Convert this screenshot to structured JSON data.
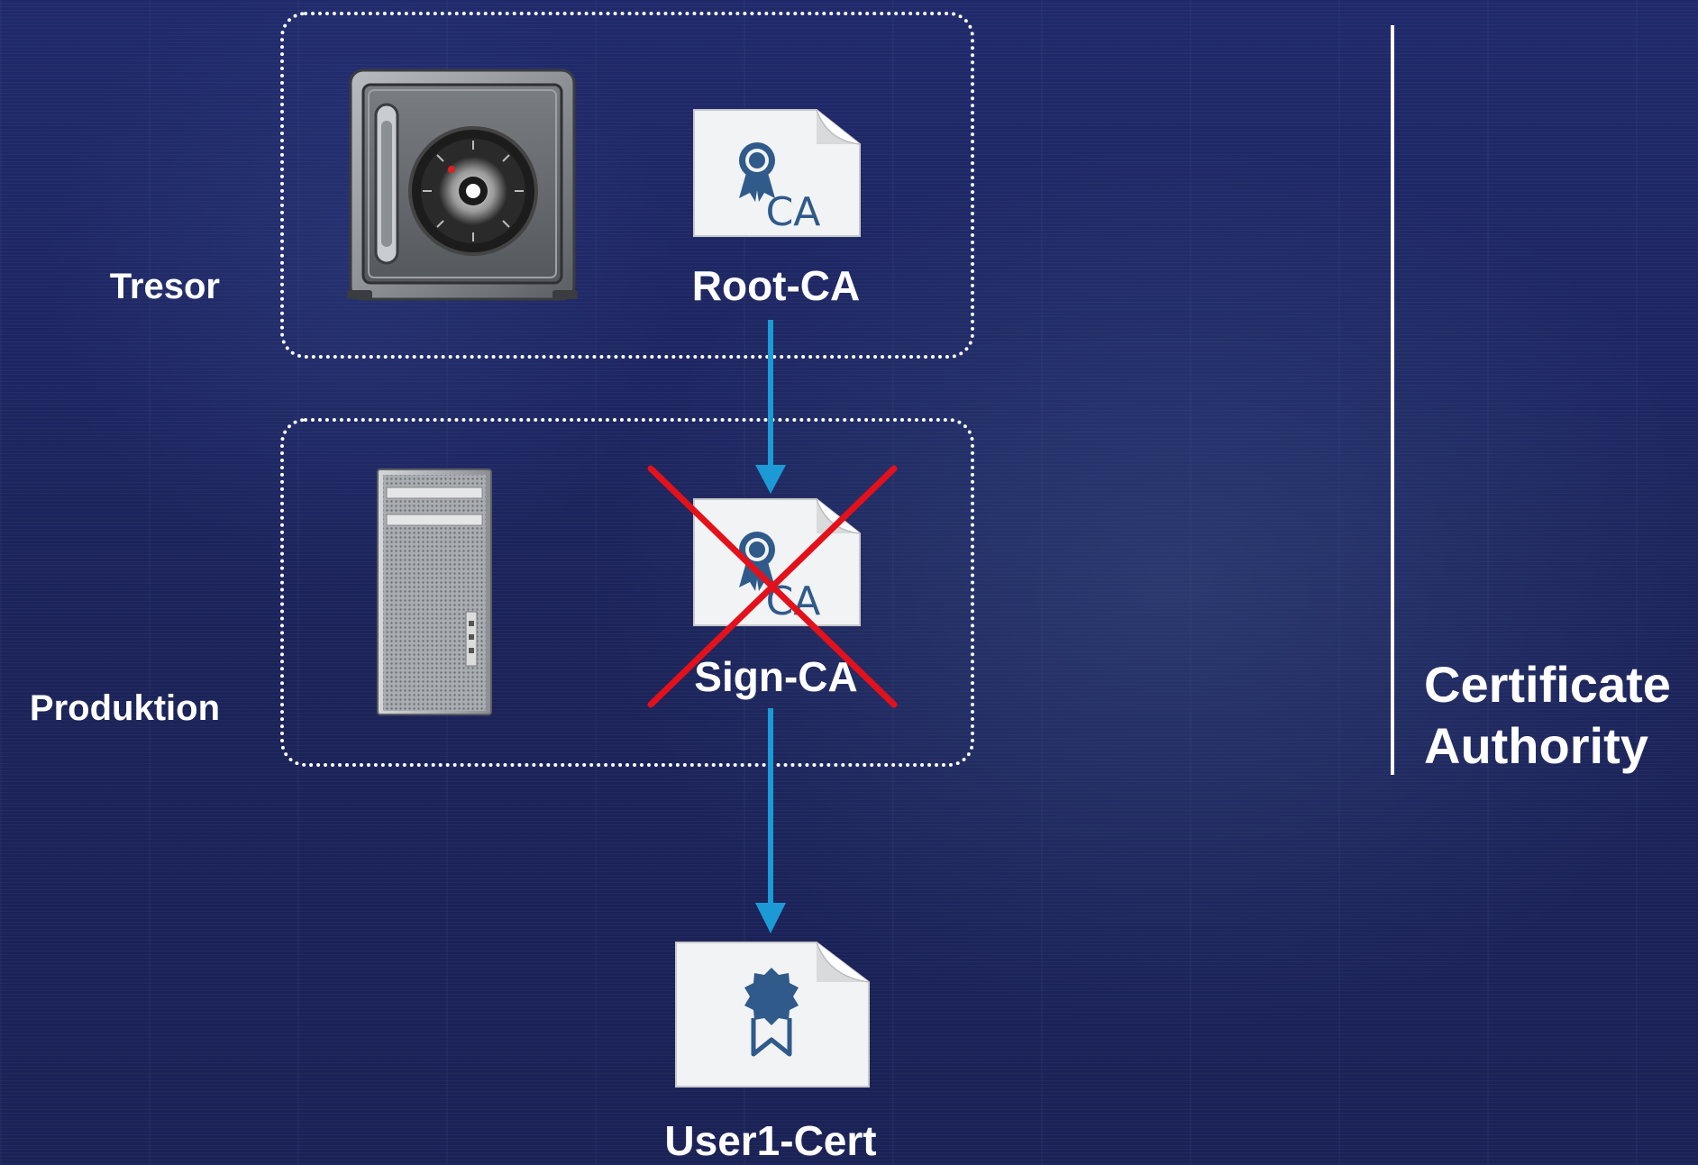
{
  "groups": {
    "tresor": {
      "label": "Tresor"
    },
    "produktion": {
      "label": "Produktion"
    }
  },
  "nodes": {
    "root_ca": {
      "label": "Root-CA",
      "badge": "CA",
      "icon": "certificate-document-icon"
    },
    "sign_ca": {
      "label": "Sign-CA",
      "badge": "CA",
      "icon": "certificate-document-icon",
      "status": "revoked"
    },
    "user_cert": {
      "label": "User1-Cert",
      "icon": "user-certificate-icon"
    }
  },
  "devices": {
    "safe": {
      "icon": "safe-icon"
    },
    "server": {
      "icon": "server-tower-icon"
    }
  },
  "sidebar": {
    "title_line1": "Certificate",
    "title_line2": "Authority"
  },
  "colors": {
    "arrow": "#1b9ad6",
    "cross": "#e3111b",
    "badge": "#2f5a8a",
    "text": "#ffffff"
  }
}
